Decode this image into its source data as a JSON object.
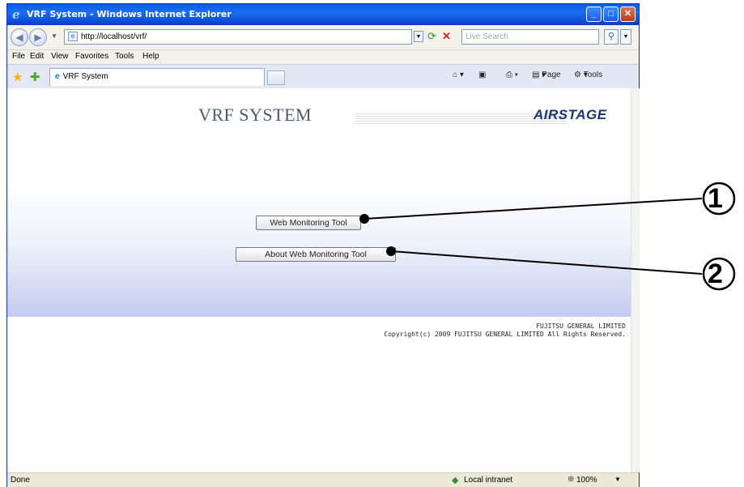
{
  "window": {
    "title": "VRF System - Windows Internet Explorer",
    "min_glyph": "_",
    "max_glyph": "□",
    "close_glyph": "✕"
  },
  "address": {
    "url": "http://localhost/vrf/",
    "search_placeholder": "Live Search"
  },
  "menu": [
    "File",
    "Edit",
    "View",
    "Favorites",
    "Tools",
    "Help"
  ],
  "tab": {
    "label": "VRF System"
  },
  "command_bar": {
    "page_label": "Page",
    "tools_label": "Tools"
  },
  "page": {
    "title": "VRF SYSTEM",
    "brand": "AIRSTAGE",
    "buttons": {
      "web_monitoring": "Web Monitoring Tool",
      "about": "About Web Monitoring Tool"
    },
    "company": "FUJITSU GENERAL LIMITED",
    "copyright": "Copyright(c) 2009 FUJITSU GENERAL LIMITED All Rights Reserved."
  },
  "status": {
    "text": "Done",
    "zone": "Local intranet",
    "zoom": "100%"
  },
  "callouts": {
    "one": "1",
    "two": "2"
  },
  "icons": {
    "back": "back-arrow-icon",
    "forward": "forward-arrow-icon",
    "refresh": "refresh-icon",
    "stop": "stop-icon",
    "search": "search-icon",
    "favorites": "favorites-star-icon",
    "home": "home-icon",
    "print": "print-icon"
  }
}
